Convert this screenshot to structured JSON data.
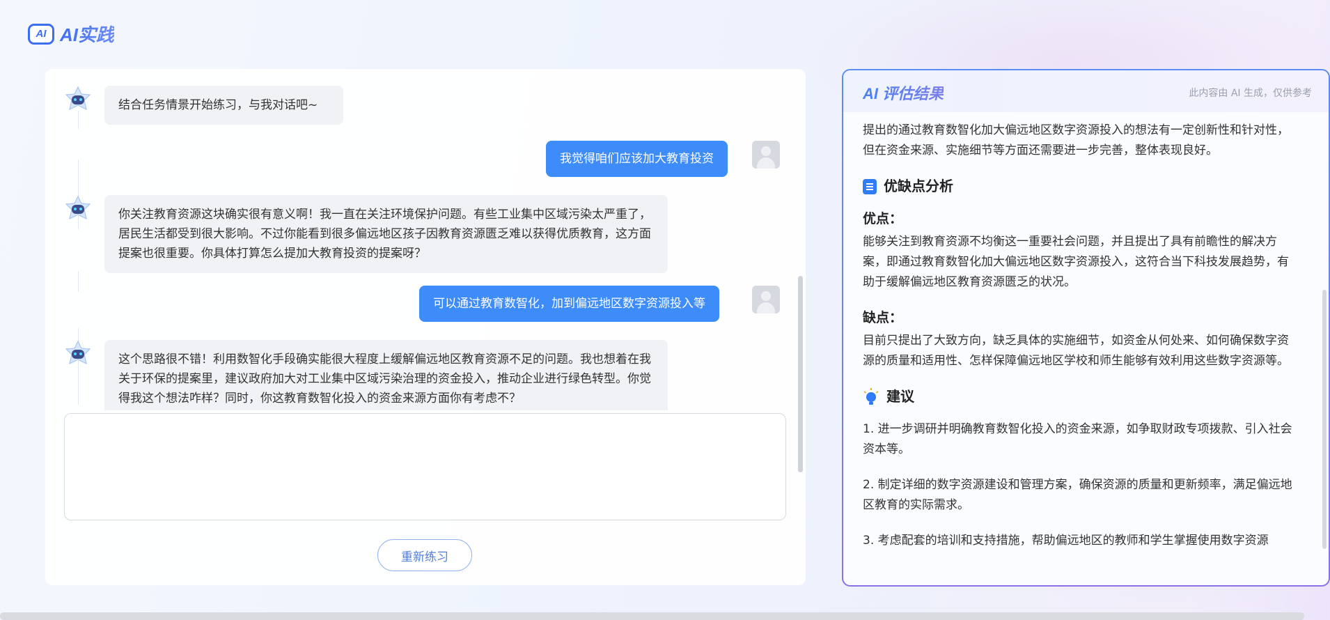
{
  "app": {
    "logo_badge": "AI",
    "logo_text": "AI实践"
  },
  "chat": {
    "messages": [
      {
        "role": "bot",
        "text": "结合任务情景开始练习，与我对话吧~"
      },
      {
        "role": "user",
        "text": "我觉得咱们应该加大教育投资"
      },
      {
        "role": "bot",
        "text": "你关注教育资源这块确实很有意义啊！我一直在关注环境保护问题。有些工业集中区域污染太严重了，居民生活都受到很大影响。不过你能看到很多偏远地区孩子因教育资源匮乏难以获得优质教育，这方面提案也很重要。你具体打算怎么提加大教育投资的提案呀？"
      },
      {
        "role": "user",
        "text": "可以通过教育数智化，加到偏远地区数字资源投入等"
      },
      {
        "role": "bot",
        "text": "这个思路很不错！利用数智化手段确实能很大程度上缓解偏远地区教育资源不足的问题。我也想着在我关于环保的提案里，建议政府加大对工业集中区域污染治理的资金投入，推动企业进行绿色转型。你觉得我这个想法咋样？同时，你这教育数智化投入的资金来源方面你有考虑不？"
      }
    ],
    "input_value": "",
    "restart_label": "重新练习"
  },
  "result": {
    "title": "AI 评估结果",
    "disclaimer": "此内容由 AI 生成，仅供参考",
    "summary": "提出的通过教育数智化加大偏远地区数字资源投入的想法有一定创新性和针对性，但在资金来源、实施细节等方面还需要进一步完善，整体表现良好。",
    "analysis_title": "优缺点分析",
    "pros_label": "优点：",
    "pros_text": "能够关注到教育资源不均衡这一重要社会问题，并且提出了具有前瞻性的解决方案，即通过教育数智化加大偏远地区数字资源投入，这符合当下科技发展趋势，有助于缓解偏远地区教育资源匮乏的状况。",
    "cons_label": "缺点：",
    "cons_text": "目前只提出了大致方向，缺乏具体的实施细节，如资金从何处来、如何确保数字资源的质量和适用性、怎样保障偏远地区学校和师生能够有效利用这些数字资源等。",
    "suggestions_title": "建议",
    "suggestions": [
      "1. 进一步调研并明确教育数智化投入的资金来源，如争取财政专项拨款、引入社会资本等。",
      "2. 制定详细的数字资源建设和管理方案，确保资源的质量和更新频率，满足偏远地区教育的实际需求。",
      "3. 考虑配套的培训和支持措施，帮助偏远地区的教师和学生掌握使用数字资源"
    ]
  },
  "colors": {
    "accent": "#3e8cf9",
    "bot_bubble": "#f0f2f5",
    "panel_border_start": "#5b8cf0",
    "panel_border_end": "#8a72e6"
  }
}
